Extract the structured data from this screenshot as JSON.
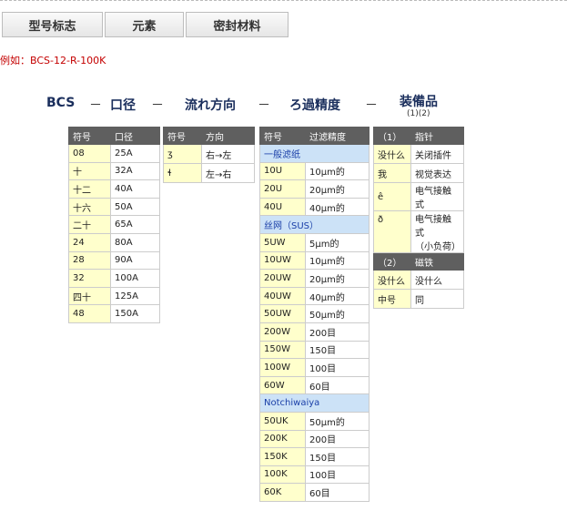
{
  "tabs": [
    "型号标志",
    "元素",
    "密封材料"
  ],
  "example": "例如：BCS-12-R-100K",
  "header": {
    "bcs": "BCS",
    "bore": "口径",
    "flow": "流れ方向",
    "filt": "ろ過精度",
    "equip": "装備品",
    "equip_sub": "(1)(2)",
    "dash": "－"
  },
  "bore": {
    "h1": "符号",
    "h2": "口径",
    "rows": [
      [
        "08",
        "25A"
      ],
      [
        "十",
        "32A"
      ],
      [
        "十二",
        "40A"
      ],
      [
        "十六",
        "50A"
      ],
      [
        "二十",
        "65A"
      ],
      [
        "24",
        "80A"
      ],
      [
        "28",
        "90A"
      ],
      [
        "32",
        "100A"
      ],
      [
        "四十",
        "125A"
      ],
      [
        "48",
        "150A"
      ]
    ]
  },
  "flow": {
    "h1": "符号",
    "h2": "方向",
    "rows": [
      [
        "ʒ",
        "右→左"
      ],
      [
        "ɬ",
        "左→右"
      ]
    ]
  },
  "filter": {
    "h1": "符号",
    "h2": "过滤精度",
    "sections": [
      {
        "label": "一般滤纸",
        "rows": [
          [
            "10U",
            "10μm的"
          ],
          [
            "20U",
            "20μm的"
          ],
          [
            "40U",
            "40μm的"
          ]
        ]
      },
      {
        "label": "丝网（SUS）",
        "rows": [
          [
            "5UW",
            "5μm的"
          ],
          [
            "10UW",
            "10μm的"
          ],
          [
            "20UW",
            "20μm的"
          ],
          [
            "40UW",
            "40μm的"
          ],
          [
            "50UW",
            "50μm的"
          ],
          [
            "200W",
            "200目"
          ],
          [
            "150W",
            "150目"
          ],
          [
            "100W",
            "100目"
          ],
          [
            "60W",
            "60目"
          ]
        ]
      },
      {
        "label": "Notchiwaiya",
        "rows": [
          [
            "50UK",
            "50μm的"
          ],
          [
            "200K",
            "200目"
          ],
          [
            "150K",
            "150目"
          ],
          [
            "100K",
            "100目"
          ],
          [
            "60K",
            "60目"
          ]
        ]
      }
    ]
  },
  "equip": {
    "s1": {
      "h1": "（1）",
      "h2": "指针",
      "rows": [
        [
          "没什么",
          "关闭插件"
        ],
        [
          "我",
          "视觉表达"
        ],
        [
          "ê",
          "电气接触式"
        ],
        [
          "ð",
          "电气接触式",
          "（小负荷）"
        ]
      ]
    },
    "s2": {
      "h1": "（2）",
      "h2": "磁铁",
      "rows": [
        [
          "没什么",
          "没什么"
        ],
        [
          "中号",
          "同"
        ]
      ]
    }
  }
}
